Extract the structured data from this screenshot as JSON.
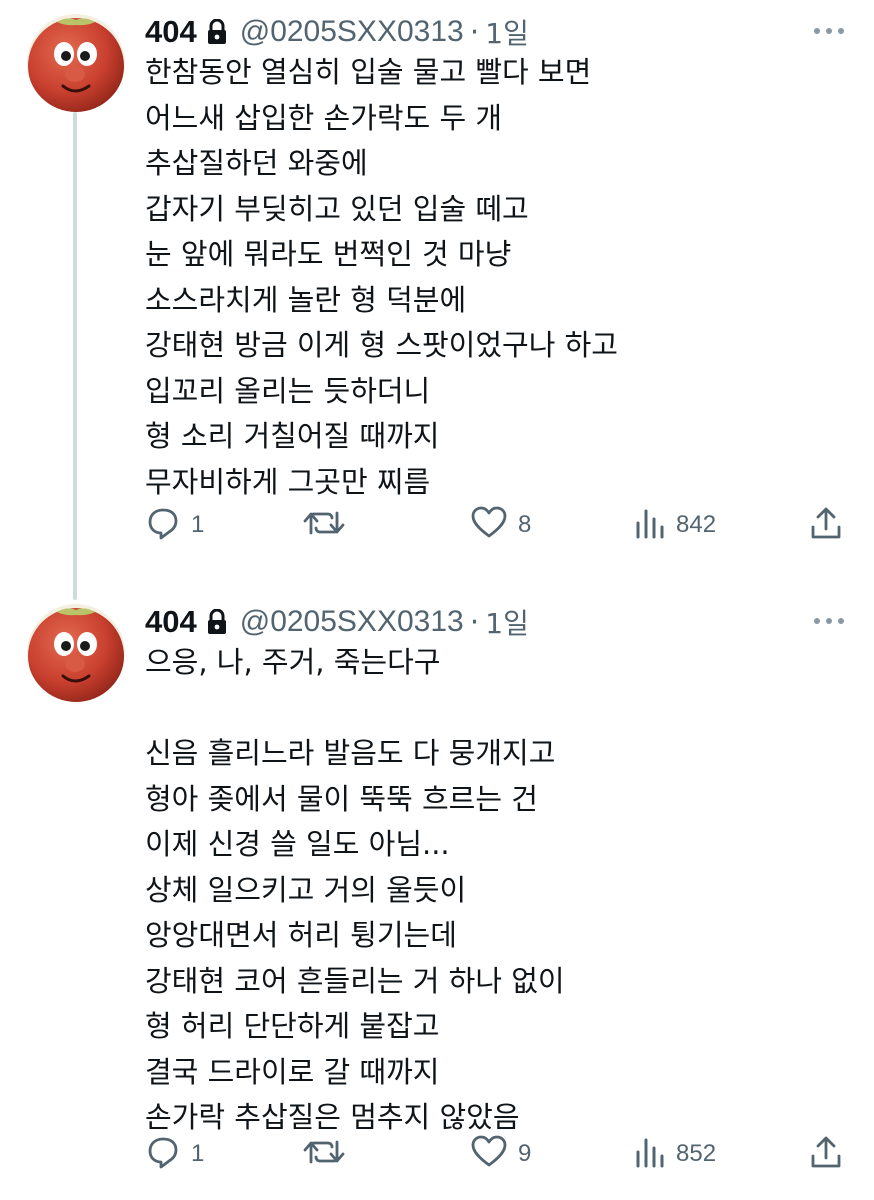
{
  "tweets": [
    {
      "display_name": "404",
      "handle": "@0205SXX0313",
      "separator": "·",
      "time": "1일",
      "lines": [
        "한참동안 열심히 입술 물고 빨다 보면",
        "어느새 삽입한 손가락도 두 개",
        "추삽질하던 와중에",
        "갑자기 부딪히고 있던 입술 떼고",
        "눈 앞에 뭐라도 번쩍인 것 마냥",
        "소스라치게 놀란 형 덕분에",
        "강태현 방금 이게 형 스팟이었구나 하고",
        "입꼬리 올리는 듯하더니",
        "형 소리 거칠어질 때까지",
        "무자비하게 그곳만 찌름"
      ],
      "replies": "1",
      "retweets": "",
      "likes": "8",
      "views": "842"
    },
    {
      "display_name": "404",
      "handle": "@0205SXX0313",
      "separator": "·",
      "time": "1일",
      "lines": [
        "으응, 나, 주거, 죽는다구",
        "",
        "신음 흘리느라 발음도 다 뭉개지고",
        "형아 좆에서 물이 뚝뚝 흐르는 건",
        "이제 신경 쓸 일도 아님...",
        "상체 일으키고 거의 울듯이",
        "앙앙대면서 허리 튕기는데",
        "강태현 코어 흔들리는 거 하나 없이",
        "형 허리 단단하게 붙잡고",
        "결국 드라이로 갈 때까지",
        "손가락 추삽질은 멈추지 않았음"
      ],
      "replies": "1",
      "retweets": "",
      "likes": "9",
      "views": "852"
    }
  ],
  "icons": {
    "avatar": "tomato-character-avatar",
    "lock": "lock-icon",
    "more": "more-dots-icon",
    "reply": "reply-icon",
    "retweet": "retweet-icon",
    "like": "heart-icon",
    "views": "views-icon",
    "share": "share-icon"
  },
  "colors": {
    "text": "#0f1419",
    "secondary": "#536471",
    "thread_line": "#cfd9de",
    "avatar_red": "#c9402f"
  }
}
